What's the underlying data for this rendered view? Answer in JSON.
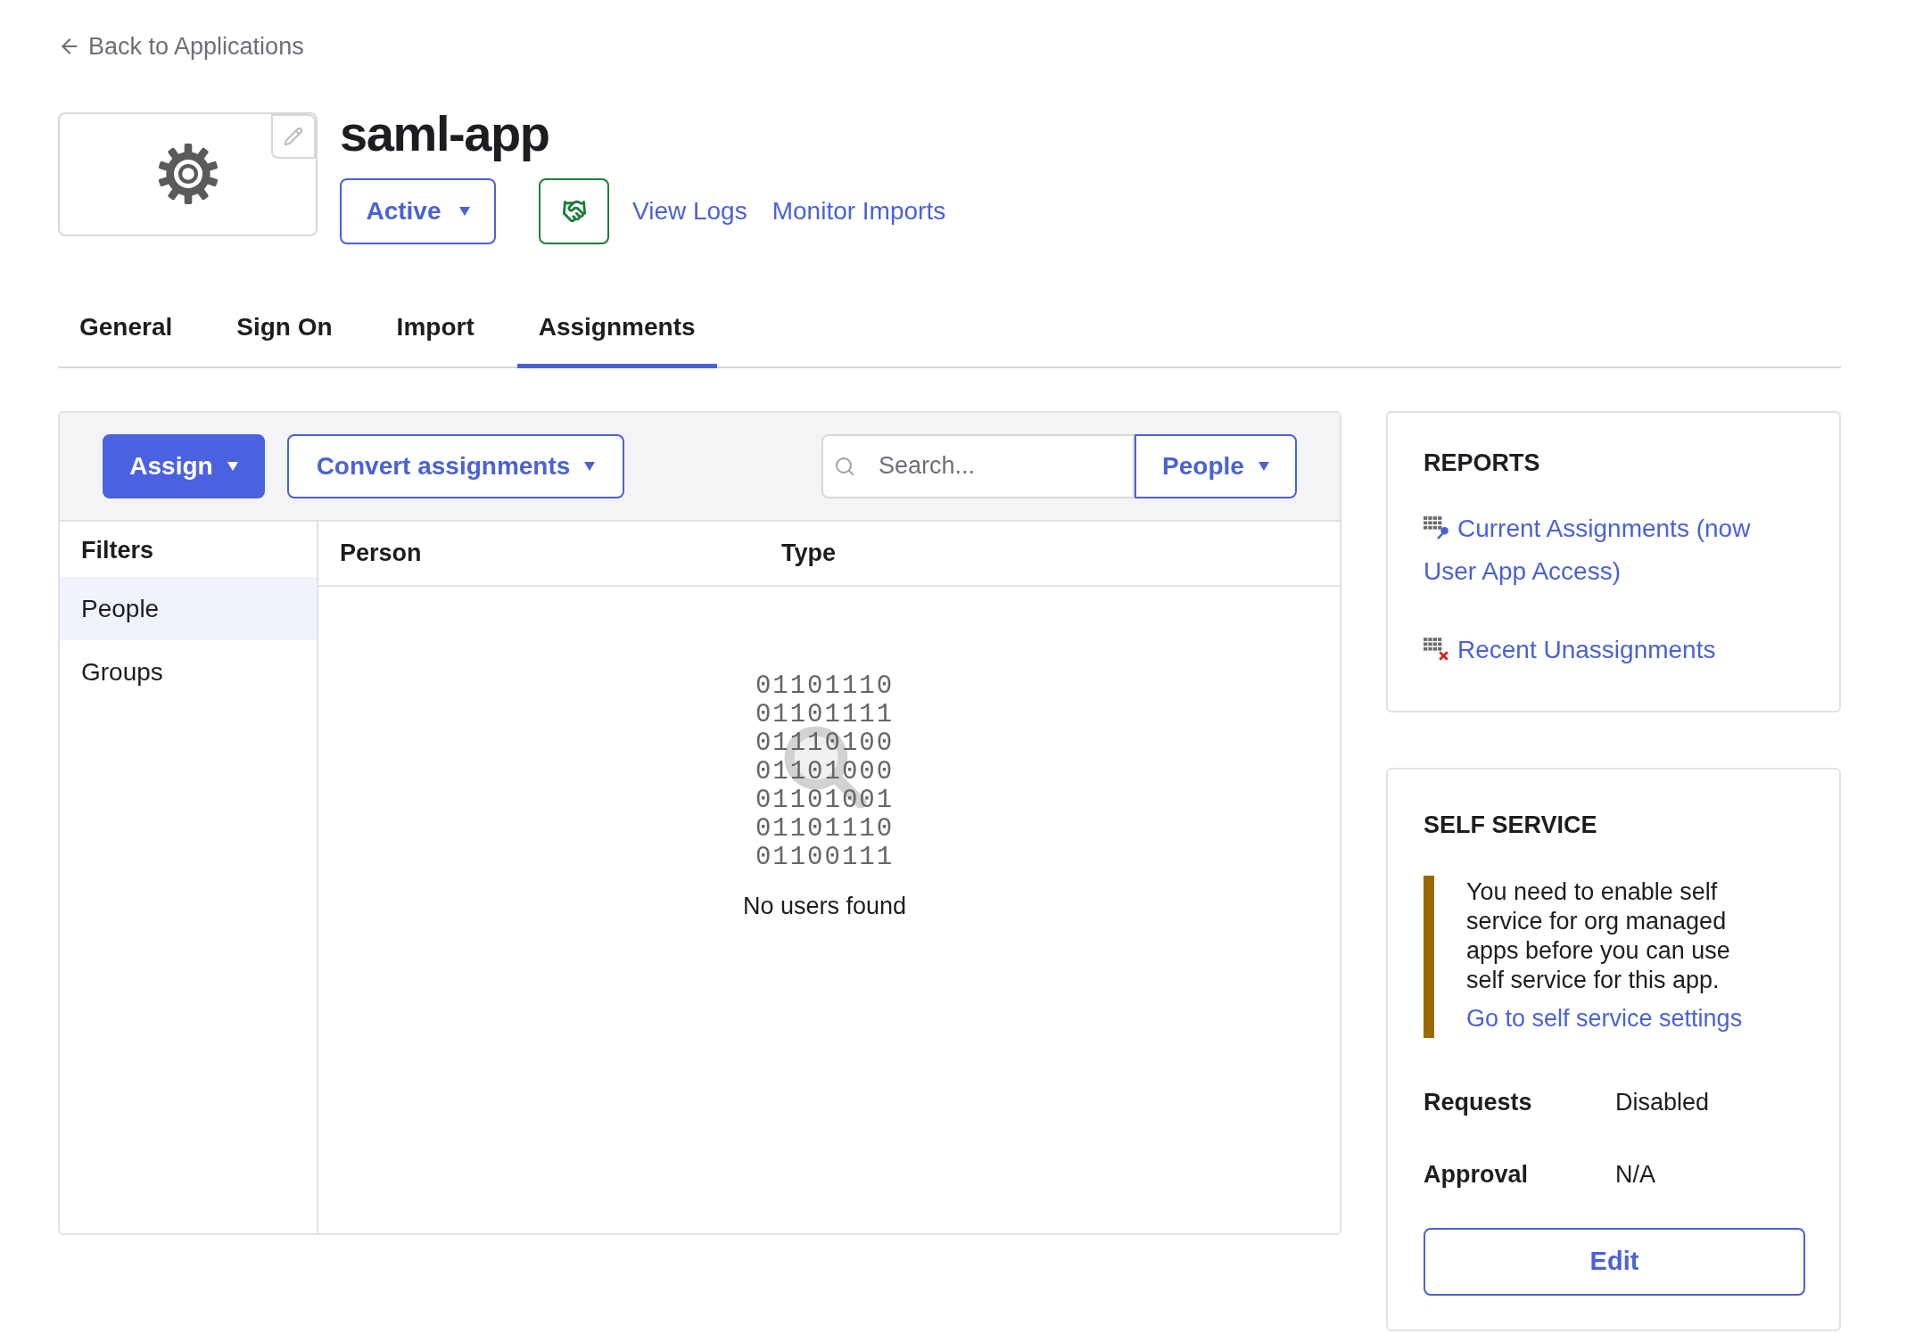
{
  "back_link": "Back to Applications",
  "app": {
    "title": "saml-app",
    "status": "Active"
  },
  "header_links": [
    "View Logs",
    "Monitor Imports"
  ],
  "tabs": [
    {
      "label": "General",
      "selected": false
    },
    {
      "label": "Sign On",
      "selected": false
    },
    {
      "label": "Import",
      "selected": false
    },
    {
      "label": "Assignments",
      "selected": true
    }
  ],
  "toolbar": {
    "assign": "Assign",
    "convert": "Convert assignments",
    "search": {
      "placeholder": "Search..."
    },
    "filter_select": "People"
  },
  "filters": {
    "title": "Filters",
    "items": [
      {
        "label": "People",
        "selected": true
      },
      {
        "label": "Groups",
        "selected": false
      }
    ]
  },
  "table": {
    "columns": [
      "Person",
      "Type"
    ],
    "empty_state": {
      "binary_lines": [
        "01101110",
        "01101111",
        "01110100",
        "01101000",
        "01101001",
        "01101110",
        "01100111"
      ],
      "message": "No users found"
    }
  },
  "reports": {
    "title": "REPORTS",
    "links": [
      {
        "kind": "current",
        "label": "Current Assignments (now User App Access)"
      },
      {
        "kind": "unassigned",
        "label": "Recent Unassignments"
      }
    ]
  },
  "self_service": {
    "title": "SELF SERVICE",
    "notice": {
      "text": "You need to enable self service for org managed apps before you can use self service for this app.",
      "link": "Go to self service settings"
    },
    "fields": [
      {
        "label": "Requests",
        "value": "Disabled"
      },
      {
        "label": "Approval",
        "value": "N/A"
      }
    ],
    "button": "Edit"
  }
}
